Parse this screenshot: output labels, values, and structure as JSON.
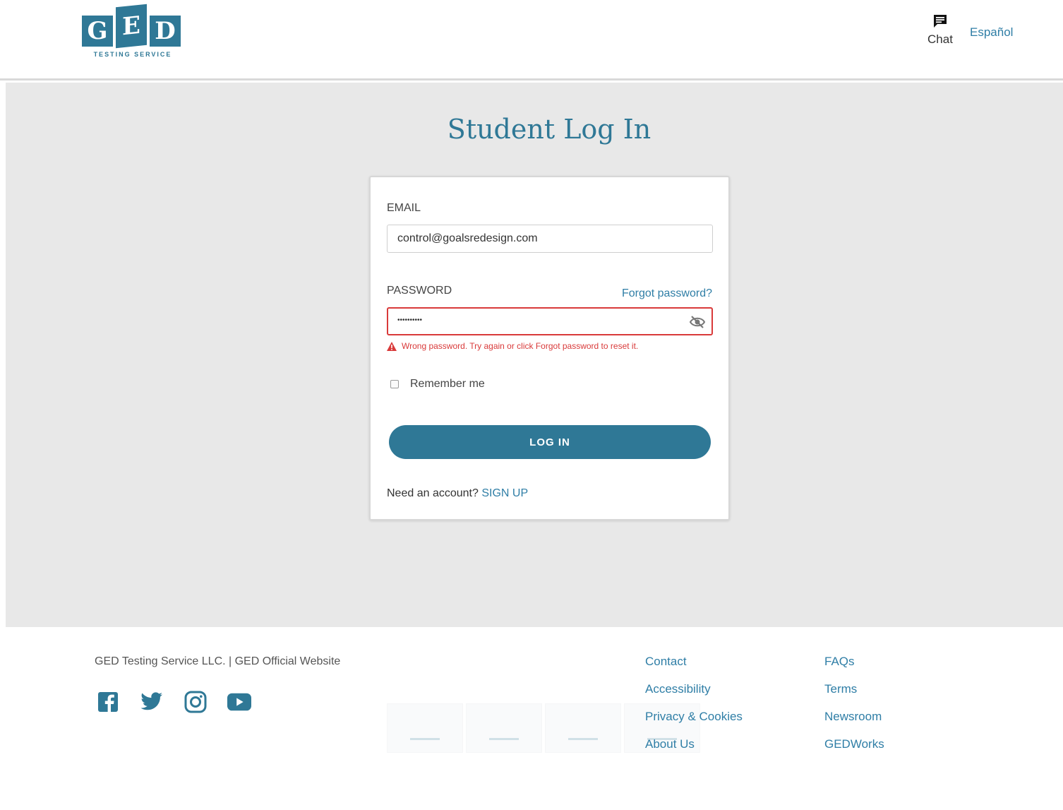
{
  "header": {
    "logo": {
      "letters": [
        "G",
        "E",
        "D"
      ],
      "subtitle": "TESTING SERVICE"
    },
    "chat_label": "Chat",
    "language_link": "Español"
  },
  "main": {
    "title": "Student Log In",
    "email": {
      "label": "EMAIL",
      "value": "control@goalsredesign.com"
    },
    "password": {
      "label": "PASSWORD",
      "forgot_link": "Forgot password?",
      "masked_value": "••••••••••",
      "error": "Wrong password. Try again or click Forgot password to reset it."
    },
    "remember_label": "Remember me",
    "login_button": "LOG IN",
    "signup_prompt": "Need an account?",
    "signup_link": "SIGN UP"
  },
  "footer": {
    "brand": "GED Testing Service LLC. | GED Official Website",
    "social_icons": [
      "facebook-icon",
      "twitter-icon",
      "instagram-icon",
      "youtube-icon"
    ],
    "col1": [
      "Contact",
      "Accessibility",
      "Privacy & Cookies",
      "About Us"
    ],
    "col2": [
      "FAQs",
      "Terms",
      "Newsroom",
      "GEDWorks"
    ]
  },
  "colors": {
    "brand": "#2f7896",
    "link": "#2f7ea6",
    "error": "#d93a3a",
    "background": "#e8e8e8"
  }
}
